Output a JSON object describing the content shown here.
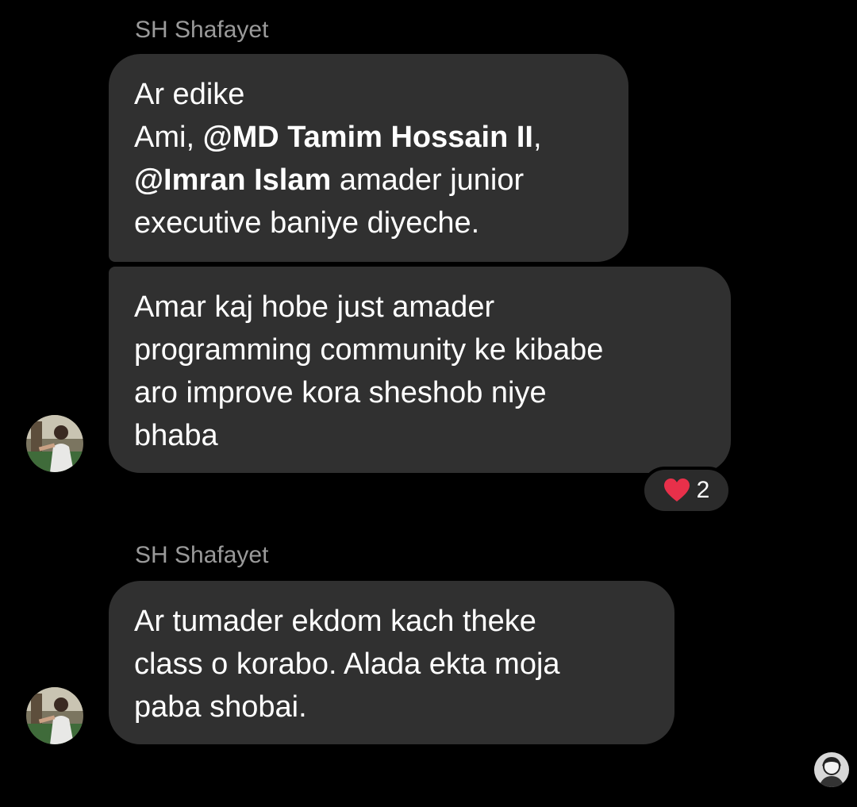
{
  "messages": [
    {
      "sender": "SH Shafayet",
      "bubbles": [
        {
          "line1": "Ar edike",
          "line2_prefix": "Ami, ",
          "mention1": "@MD Tamim Hossain II",
          "line2_suffix": ",",
          "mention2": "@Imran Islam",
          "line3_suffix": " amader junior",
          "line4": "executive baniye diyeche."
        },
        {
          "lines": [
            "Amar kaj hobe just amader",
            "programming community ke kibabe",
            "aro improve kora sheshob niye",
            "bhaba"
          ],
          "reaction": {
            "icon": "heart-icon",
            "count": "2",
            "color": "#e8304a"
          }
        }
      ]
    },
    {
      "sender": "SH Shafayet",
      "bubbles": [
        {
          "lines": [
            "Ar tumader ekdom kach theke",
            "class o korabo. Alada ekta moja",
            "paba shobai."
          ]
        }
      ]
    }
  ],
  "colors": {
    "background": "#000000",
    "bubble": "#303030",
    "sender_name": "#9a9a9a",
    "text": "#ffffff"
  }
}
